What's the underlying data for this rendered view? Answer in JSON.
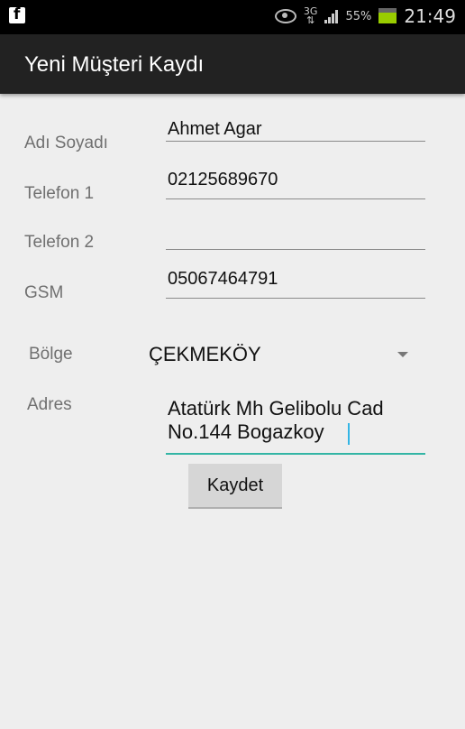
{
  "status_bar": {
    "app_icon": "facebook-icon",
    "network": "3G",
    "battery": "55%",
    "time": "21:49"
  },
  "app_bar": {
    "title": "Yeni Müşteri Kaydı"
  },
  "form": {
    "name_label": "Adı Soyadı",
    "name_value": "Ahmet Agar",
    "phone1_label": "Telefon 1",
    "phone1_value": "02125689670",
    "phone2_label": "Telefon 2",
    "phone2_value": "",
    "gsm_label": "GSM",
    "gsm_value": "05067464791",
    "region_label": "Bölge",
    "region_value": "ÇEKMEKÖY",
    "address_label": "Adres",
    "address_value": "Atatürk Mh Gelibolu Cad\nNo.144 Bogazkoy",
    "save_label": "Kaydet"
  },
  "colors": {
    "accent": "#33b5a5",
    "appbar": "#222222",
    "background": "#eeeeee"
  }
}
